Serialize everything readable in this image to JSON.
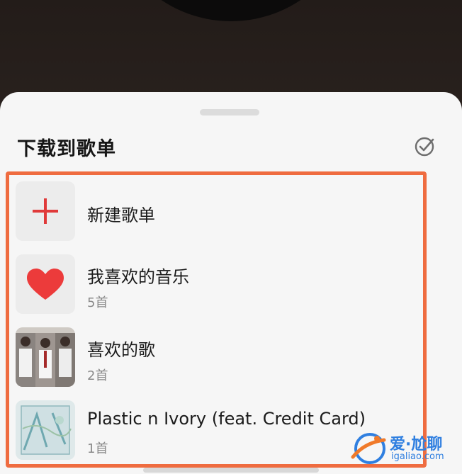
{
  "sheet": {
    "title": "下载到歌单",
    "multiselect_icon": "check-circle-icon"
  },
  "playlists": [
    {
      "title": "新建歌单",
      "count": "",
      "icon": "plus-icon"
    },
    {
      "title": "我喜欢的音乐",
      "count": "5首",
      "icon": "heart-icon"
    },
    {
      "title": "喜欢的歌",
      "count": "2首",
      "icon": "photo-cover"
    },
    {
      "title": "Plastic n Ivory (feat. Credit Card)",
      "count": "1首",
      "icon": "art-cover"
    }
  ],
  "watermark": {
    "main": "爱·尬聊",
    "sub": "igaliao.com"
  },
  "colors": {
    "accent": "#e03a3a",
    "highlight": "#ef6c40",
    "watermark": "#2f7fe0"
  }
}
